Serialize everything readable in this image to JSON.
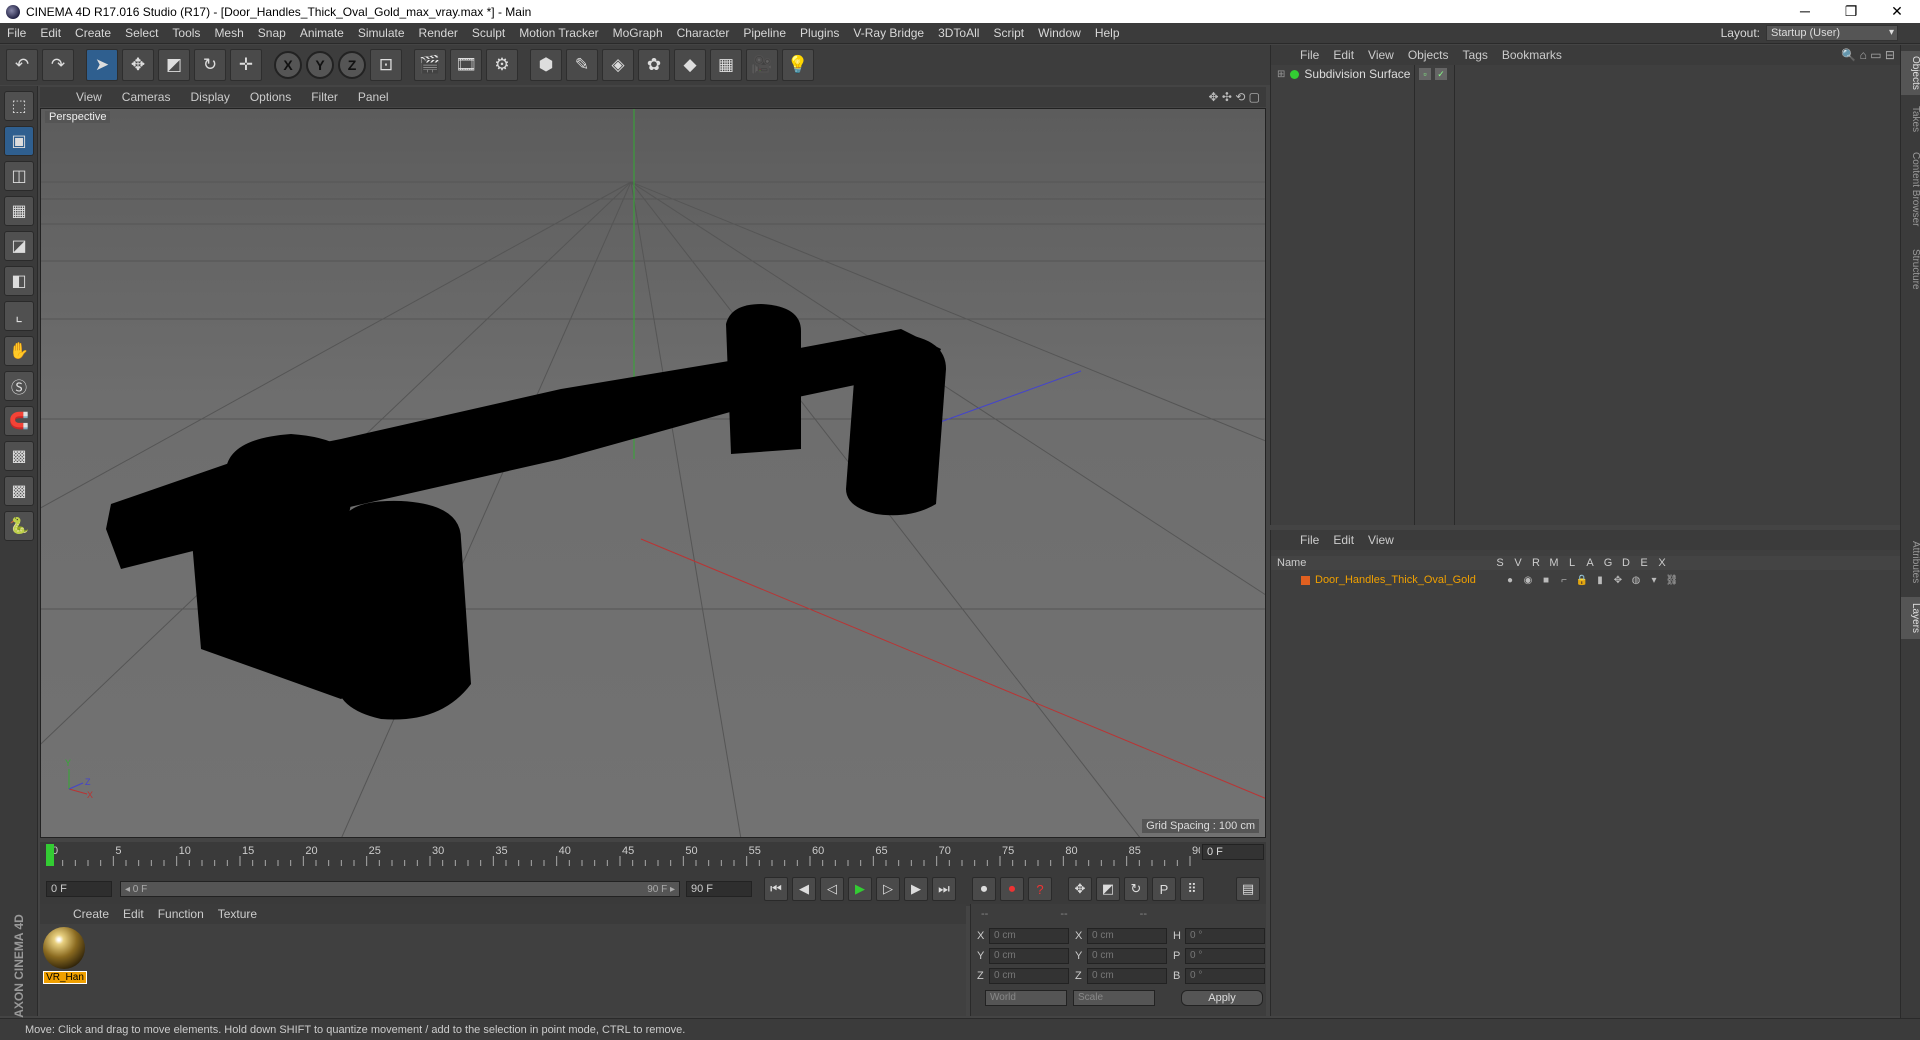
{
  "window": {
    "title": "CINEMA 4D R17.016 Studio (R17) - [Door_Handles_Thick_Oval_Gold_max_vray.max *] - Main",
    "min": "─",
    "restore": "❐",
    "close": "✕"
  },
  "menubar": {
    "items": [
      "File",
      "Edit",
      "Create",
      "Select",
      "Tools",
      "Mesh",
      "Snap",
      "Animate",
      "Simulate",
      "Render",
      "Sculpt",
      "Motion Tracker",
      "MoGraph",
      "Character",
      "Pipeline",
      "Plugins",
      "V-Ray Bridge",
      "3DToAll",
      "Script",
      "Window",
      "Help"
    ],
    "layout_label": "Layout:",
    "layout_value": "Startup (User)"
  },
  "toolbar": {
    "undo": "↶",
    "redo": "↷",
    "select": "➤",
    "move": "✥",
    "scale": "◩",
    "rotate": "↻",
    "last": "✛",
    "x": "X",
    "y": "Y",
    "z": "Z",
    "coord": "⊡",
    "render_view": "🎬",
    "render_pv": "🎞",
    "render_settings": "⚙",
    "cube": "⬢",
    "pen": "✎",
    "subdiv": "◈",
    "array": "✿",
    "deform": "◆",
    "floor": "▦",
    "camera": "🎥",
    "light": "💡"
  },
  "lefttools": [
    "⬚",
    "▣",
    "◫",
    "▦",
    "◪",
    "◧",
    "⌞",
    "✋",
    "Ⓢ",
    "🧲",
    "▩",
    "▩",
    "🐍"
  ],
  "viewport": {
    "menu": [
      "View",
      "Cameras",
      "Display",
      "Options",
      "Filter",
      "Panel"
    ],
    "nav": "✥ ✣ ⟲ ▢",
    "label": "Perspective",
    "grid_spacing": "Grid Spacing : 100 cm",
    "axis_y": "Y",
    "axis_z": "Z",
    "axis_x": "X"
  },
  "timeline": {
    "ticks": [
      "0",
      "5",
      "10",
      "15",
      "20",
      "25",
      "30",
      "35",
      "40",
      "45",
      "50",
      "55",
      "60",
      "65",
      "70",
      "75",
      "80",
      "85",
      "90"
    ],
    "current_frame": "0 F"
  },
  "transport": {
    "start": "0 F",
    "range_start": "◂ 0 F",
    "range_end": "90 F ▸",
    "end": "90 F",
    "first": "⏮",
    "prev_key": "◀",
    "prev": "◁",
    "play": "▶",
    "next": "▷",
    "next_key": "▶",
    "last": "⏭",
    "record": "⏺",
    "auto": "⏺",
    "key": "?",
    "move_k": "✥",
    "scale_k": "◩",
    "rot_k": "↻",
    "param_k": "P",
    "grid_k": "⠿",
    "timeline_k": "▤"
  },
  "matmgr": {
    "menu": [
      "Create",
      "Edit",
      "Function",
      "Texture"
    ],
    "material_label": "VR_Han"
  },
  "coords": {
    "header": [
      "--",
      "--",
      "--"
    ],
    "rows": [
      {
        "a": "X",
        "av": "0 cm",
        "b": "X",
        "bv": "0 cm",
        "c": "H",
        "cv": "0 °"
      },
      {
        "a": "Y",
        "av": "0 cm",
        "b": "Y",
        "bv": "0 cm",
        "c": "P",
        "cv": "0 °"
      },
      {
        "a": "Z",
        "av": "0 cm",
        "b": "Z",
        "bv": "0 cm",
        "c": "B",
        "cv": "0 °"
      }
    ],
    "world": "World",
    "scale": "Scale",
    "apply": "Apply"
  },
  "objects": {
    "menu": [
      "File",
      "Edit",
      "View",
      "Objects",
      "Tags",
      "Bookmarks"
    ],
    "item": "Subdivision Surface",
    "icons": "🔍 ⌂ ▭ ⊟"
  },
  "layers": {
    "menu": [
      "File",
      "Edit",
      "View"
    ],
    "header_name": "Name",
    "flags": [
      "S",
      "V",
      "R",
      "M",
      "L",
      "A",
      "G",
      "D",
      "E",
      "X"
    ],
    "layer_name": "Door_Handles_Thick_Oval_Gold",
    "layer_icons": [
      "●",
      "◉",
      "■",
      "⌐",
      "🔒",
      "▮",
      "✥",
      "◍",
      "▾",
      "⛓"
    ]
  },
  "side_tabs": [
    "Objects",
    "Takes",
    "Content Browser",
    "Structure",
    "Attributes",
    "Layers"
  ],
  "status": "Move: Click and drag to move elements. Hold down SHIFT to quantize movement / add to the selection in point mode, CTRL to remove.",
  "maxon": "MAXON CINEMA 4D"
}
